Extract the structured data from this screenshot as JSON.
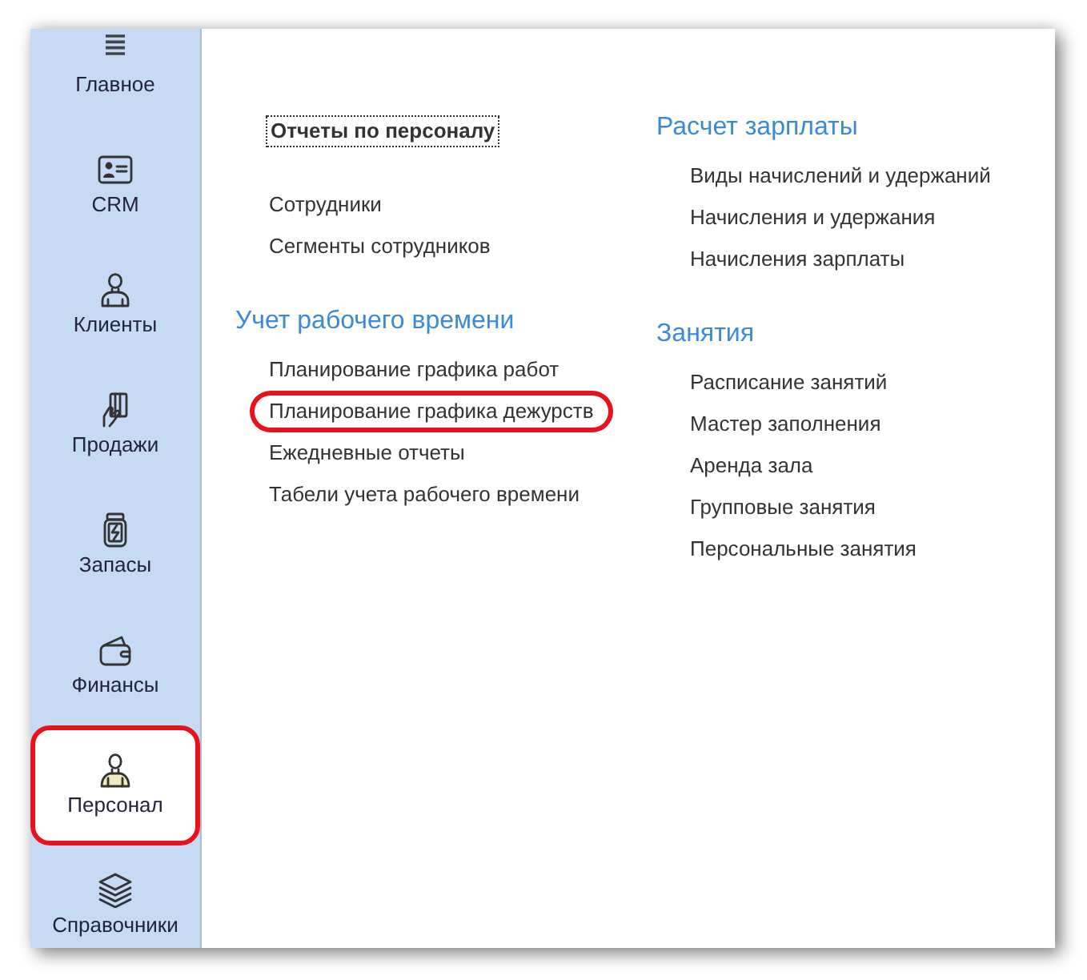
{
  "sidebar": {
    "items": [
      {
        "label": "Главное",
        "selected": false,
        "highlighted": false
      },
      {
        "label": "CRM",
        "selected": false,
        "highlighted": false
      },
      {
        "label": "Клиенты",
        "selected": false,
        "highlighted": false
      },
      {
        "label": "Продажи",
        "selected": false,
        "highlighted": false
      },
      {
        "label": "Запасы",
        "selected": false,
        "highlighted": false
      },
      {
        "label": "Финансы",
        "selected": false,
        "highlighted": false
      },
      {
        "label": "Персонал",
        "selected": true,
        "highlighted": true
      },
      {
        "label": "Справочники",
        "selected": false,
        "highlighted": false
      }
    ]
  },
  "content": {
    "columns": [
      {
        "sections": [
          {
            "kind": "command",
            "label": "Отчеты по персоналу",
            "focused": true
          },
          {
            "kind": "links",
            "items": [
              {
                "label": "Сотрудники",
                "highlighted": false
              },
              {
                "label": "Сегменты сотрудников",
                "highlighted": false
              }
            ]
          },
          {
            "kind": "links",
            "title": "Учет рабочего времени",
            "items": [
              {
                "label": "Планирование графика работ",
                "highlighted": false
              },
              {
                "label": "Планирование графика дежурств",
                "highlighted": true
              },
              {
                "label": "Ежедневные отчеты",
                "highlighted": false
              },
              {
                "label": "Табели учета рабочего времени",
                "highlighted": false
              }
            ]
          }
        ]
      },
      {
        "sections": [
          {
            "kind": "links",
            "title": "Расчет зарплаты",
            "items": [
              {
                "label": "Виды начислений и удержаний",
                "highlighted": false
              },
              {
                "label": "Начисления и удержания",
                "highlighted": false
              },
              {
                "label": "Начисления зарплаты",
                "highlighted": false
              }
            ]
          },
          {
            "kind": "links",
            "title": "Занятия",
            "items": [
              {
                "label": "Расписание занятий",
                "highlighted": false
              },
              {
                "label": "Мастер заполнения",
                "highlighted": false
              },
              {
                "label": "Аренда зала",
                "highlighted": false
              },
              {
                "label": "Групповые занятия",
                "highlighted": false
              },
              {
                "label": "Персональные занятия",
                "highlighted": false
              }
            ]
          }
        ]
      }
    ]
  }
}
